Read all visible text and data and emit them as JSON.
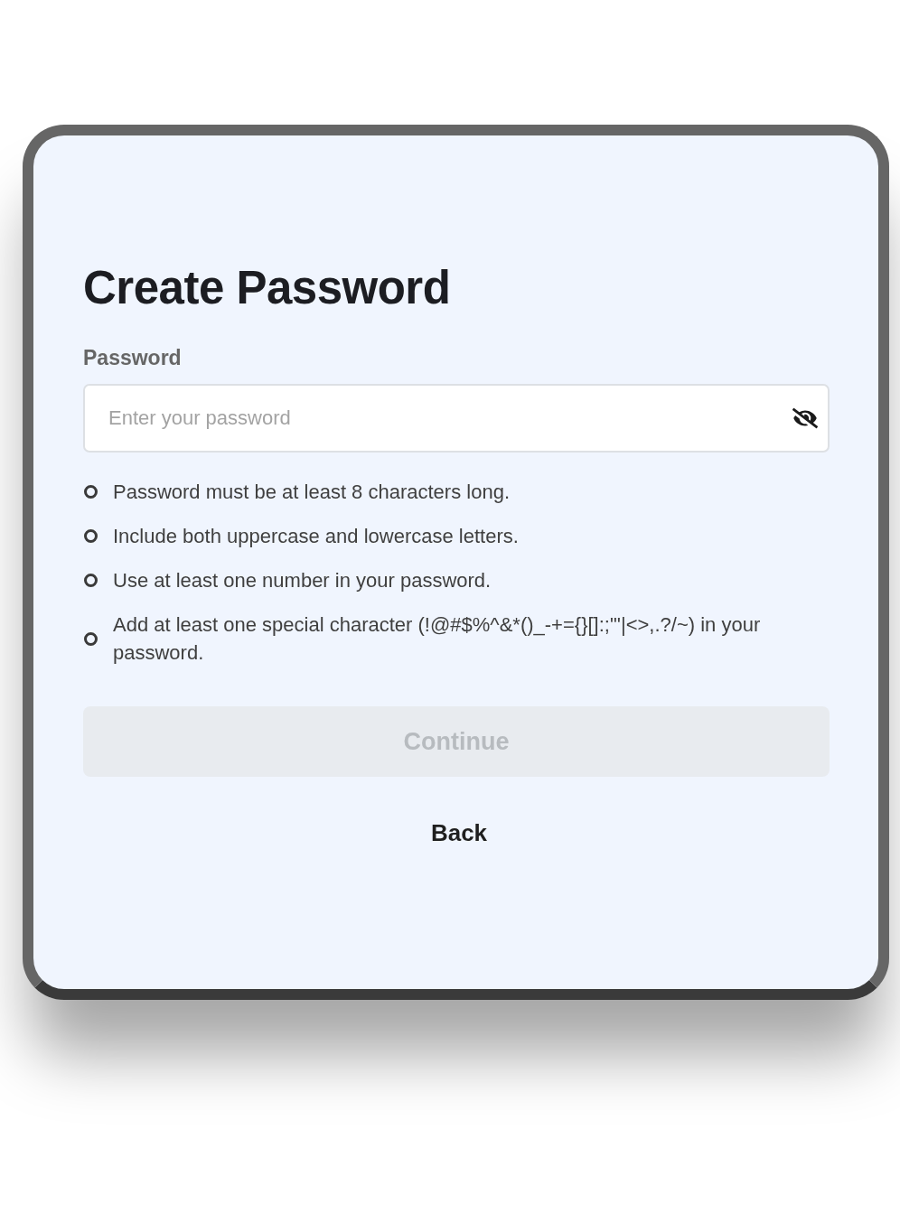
{
  "title": "Create Password",
  "password_field": {
    "label": "Password",
    "placeholder": "Enter your password",
    "show_password": false
  },
  "requirements": [
    {
      "text": "Password must be at least 8 characters long.",
      "met": false
    },
    {
      "text": "Include both uppercase and lowercase letters.",
      "met": false
    },
    {
      "text": "Use at least one number in your password.",
      "met": false
    },
    {
      "text": "Add at least one special character (!@#$%^&*()_-+={}[]:;\"'|<>,.?/~) in your password.",
      "met": false
    }
  ],
  "continue_button": {
    "label": "Continue",
    "disabled": true
  },
  "back_link": {
    "label": "Back"
  }
}
